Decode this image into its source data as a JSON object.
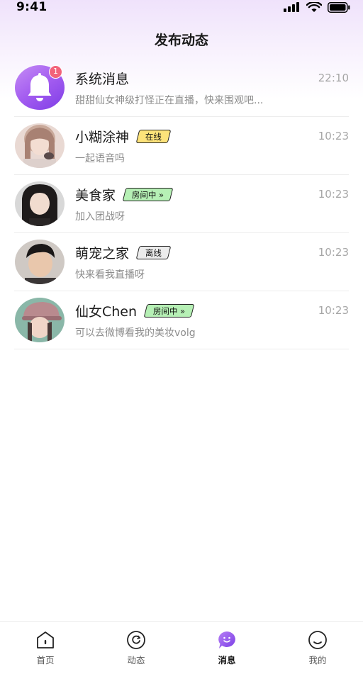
{
  "status_bar": {
    "time": "9:41"
  },
  "header": {
    "title": "发布动态"
  },
  "messages": [
    {
      "name": "系统消息",
      "preview": "甜甜仙女神级打怪正在直播，快来围观吧...",
      "time": "22:10",
      "badge": null,
      "unread": "1",
      "avatar": "bell-icon"
    },
    {
      "name": "小糊涂神",
      "preview": "一起语音吗",
      "time": "10:23",
      "badge": "在线",
      "badge_type": "online",
      "avatar": "user-avatar"
    },
    {
      "name": "美食家",
      "preview": "加入团战呀",
      "time": "10:23",
      "badge": "房间中 »",
      "badge_type": "room",
      "avatar": "user-avatar"
    },
    {
      "name": "萌宠之家",
      "preview": "快来看我直播呀",
      "time": "10:23",
      "badge": "离线",
      "badge_type": "offline",
      "avatar": "user-avatar"
    },
    {
      "name": "仙女Chen",
      "preview": "可以去微博看我的美妆volg",
      "time": "10:23",
      "badge": "房间中 »",
      "badge_type": "room",
      "avatar": "user-avatar"
    }
  ],
  "tabbar": {
    "items": [
      {
        "label": "首页",
        "icon": "home-icon"
      },
      {
        "label": "动态",
        "icon": "feed-icon"
      },
      {
        "label": "消息",
        "icon": "message-icon",
        "active": true
      },
      {
        "label": "我的",
        "icon": "profile-icon"
      }
    ]
  },
  "colors": {
    "accent": "#8a4bee",
    "badge_online": "#fde37a",
    "badge_room": "#b6f0b5",
    "badge_offline": "#ececec",
    "unread": "#f2637a"
  }
}
